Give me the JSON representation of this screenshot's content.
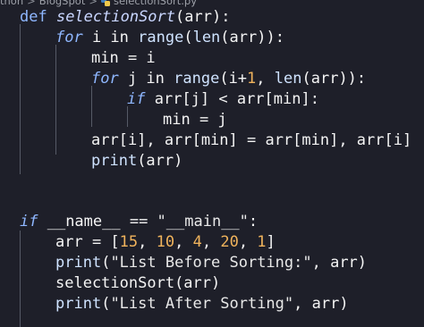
{
  "breadcrumb": {
    "segments": [
      "thon",
      "BlogSpot",
      "selectionSort.py"
    ],
    "separator": ">",
    "file_icon": "python-file-icon"
  },
  "code": {
    "lines": [
      [
        {
          "t": "def ",
          "c": "kw-def"
        },
        {
          "t": "selectionSort",
          "c": "fn"
        },
        {
          "t": "(arr):",
          "c": "txt"
        }
      ],
      [
        {
          "t": "for",
          "c": "kw"
        },
        {
          "t": " i in ",
          "c": "txt"
        },
        {
          "t": "range",
          "c": "builtin"
        },
        {
          "t": "(",
          "c": "txt"
        },
        {
          "t": "len",
          "c": "builtin"
        },
        {
          "t": "(arr)):",
          "c": "txt"
        }
      ],
      [
        {
          "t": "min = i",
          "c": "txt"
        }
      ],
      [
        {
          "t": "for",
          "c": "kw"
        },
        {
          "t": " j in ",
          "c": "txt"
        },
        {
          "t": "range",
          "c": "builtin"
        },
        {
          "t": "(i+",
          "c": "txt"
        },
        {
          "t": "1",
          "c": "num"
        },
        {
          "t": ", ",
          "c": "txt"
        },
        {
          "t": "len",
          "c": "builtin"
        },
        {
          "t": "(arr)):",
          "c": "txt"
        }
      ],
      [
        {
          "t": "if",
          "c": "kw"
        },
        {
          "t": " arr[j] < arr[min]:",
          "c": "txt"
        }
      ],
      [
        {
          "t": "min = j",
          "c": "txt"
        }
      ],
      [
        {
          "t": "arr[i], arr[min] = arr[min], arr[i]",
          "c": "txt"
        }
      ],
      [
        {
          "t": "print",
          "c": "builtin"
        },
        {
          "t": "(arr)",
          "c": "txt"
        }
      ],
      [],
      [],
      [
        {
          "t": "if",
          "c": "kw"
        },
        {
          "t": " __name__ == ",
          "c": "txt"
        },
        {
          "t": "\"__main__\"",
          "c": "str"
        },
        {
          "t": ":",
          "c": "txt"
        }
      ],
      [
        {
          "t": "arr = [",
          "c": "txt"
        },
        {
          "t": "15",
          "c": "num"
        },
        {
          "t": ", ",
          "c": "txt"
        },
        {
          "t": "10",
          "c": "num"
        },
        {
          "t": ", ",
          "c": "txt"
        },
        {
          "t": "4",
          "c": "num"
        },
        {
          "t": ", ",
          "c": "txt"
        },
        {
          "t": "20",
          "c": "num"
        },
        {
          "t": ", ",
          "c": "txt"
        },
        {
          "t": "1",
          "c": "num"
        },
        {
          "t": "]",
          "c": "txt"
        }
      ],
      [
        {
          "t": "print",
          "c": "builtin"
        },
        {
          "t": "(",
          "c": "txt"
        },
        {
          "t": "\"List Before Sorting:\"",
          "c": "str"
        },
        {
          "t": ", arr)",
          "c": "txt"
        }
      ],
      [
        {
          "t": "selectionSort",
          "c": "txt"
        },
        {
          "t": "(arr)",
          "c": "txt"
        }
      ],
      [
        {
          "t": "print",
          "c": "builtin"
        },
        {
          "t": "(",
          "c": "txt"
        },
        {
          "t": "\"List After Sorting\"",
          "c": "str"
        },
        {
          "t": ", arr)",
          "c": "txt"
        }
      ]
    ]
  },
  "colors": {
    "background": "#1e1f29",
    "keyword": "#8fb7ff",
    "number": "#f0b35c",
    "text": "#f4f4f4",
    "indent_guide": "#565a66"
  }
}
